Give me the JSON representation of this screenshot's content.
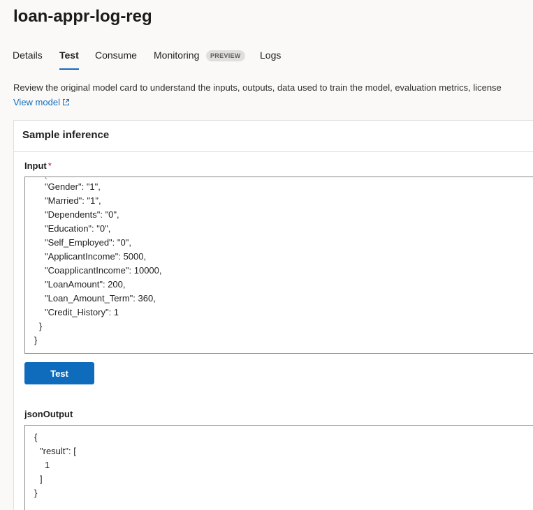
{
  "title": "loan-appr-log-reg",
  "tabs": [
    {
      "label": "Details"
    },
    {
      "label": "Test"
    },
    {
      "label": "Consume"
    },
    {
      "label": "Monitoring",
      "badge": "PREVIEW"
    },
    {
      "label": "Logs"
    }
  ],
  "description": "Review the original model card to understand the inputs, outputs, data used to train the model, evaluation metrics, license",
  "view_model_label": "View model",
  "colors": {
    "accent": "#0f6cbd",
    "required": "#c50f1f"
  },
  "sample_inference": {
    "header": "Sample inference",
    "input_label": "Input",
    "required_mark": "*",
    "input_lines": [
      "\"Gender\": \"1\",",
      "\"Married\": \"1\",",
      "\"Dependents\": \"0\",",
      "\"Education\": \"0\",",
      "\"Self_Employed\": \"0\",",
      "\"ApplicantIncome\": 5000,",
      "\"CoapplicantIncome\": 10000,",
      "\"LoanAmount\": 200,",
      "\"Loan_Amount_Term\": 360,",
      "\"Credit_History\": 1",
      "}",
      "}"
    ],
    "test_button": "Test",
    "output_label": "jsonOutput",
    "output_lines": [
      "{",
      "\"result\": [",
      "1",
      "]",
      "}"
    ]
  }
}
